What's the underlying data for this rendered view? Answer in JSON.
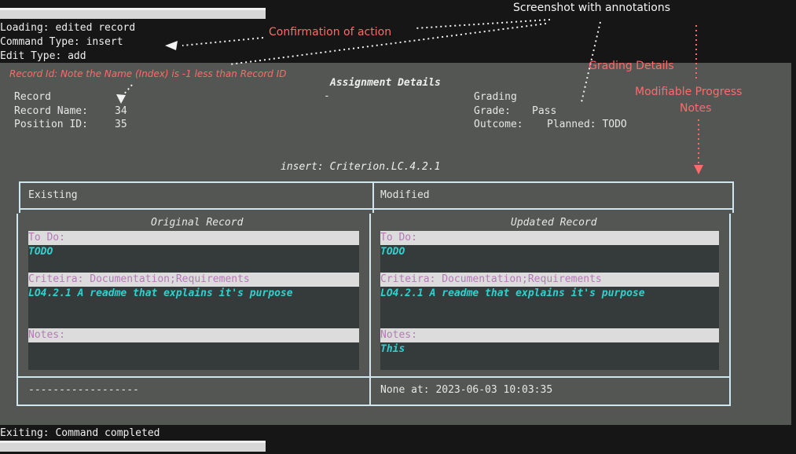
{
  "terminal_top": {
    "lines": [
      "Loading: edited record",
      "Command Type: insert",
      "Edit Type: add"
    ]
  },
  "terminal_bottom": {
    "exit_line": "Exiting: Command completed"
  },
  "annotations": {
    "title": "Screenshot with annotations",
    "confirmation": "Confirmation of action",
    "record_id_note": "Record Id: Note the Name (Index) is -1 less than Record ID",
    "grading_details": "Grading Details",
    "modifiable_notes_line1": "Modifiable Progress",
    "modifiable_notes_line2": "Notes"
  },
  "assignment": {
    "heading": "Assignment Details",
    "dash": "-",
    "record_label": "Record",
    "record_name_label": "Record Name:",
    "record_name_value": "34",
    "position_id_label": "Position ID:",
    "position_id_value": "35",
    "grading_label": "Grading",
    "grade_label": "Grade:",
    "grade_value": "Pass",
    "outcome_label": "Outcome:",
    "outcome_value": "Planned: TODO"
  },
  "action_line": "insert: Criterion.LC.4.2.1",
  "table": {
    "existing_header": "Existing",
    "modified_header": "Modified",
    "original_title": "Original Record",
    "updated_title": "Updated Record",
    "original": {
      "todo_label": "To Do:",
      "todo_value": "TODO",
      "criteria_label": "Criteira: Documentation;Requirements",
      "criteria_value": "LO4.2.1 A readme that explains it's purpose",
      "notes_label": "Notes:",
      "notes_value": ""
    },
    "updated": {
      "todo_label": "To Do:",
      "todo_value": "TODO",
      "criteria_label": "Criteira: Documentation;Requirements",
      "criteria_value": "LO4.2.1 A readme that explains it's purpose",
      "notes_label": "Notes:",
      "notes_value": "This"
    },
    "footer_left": "------------------",
    "footer_right": "None at: 2023-06-03 10:03:35"
  },
  "colors": {
    "background": "#161616",
    "panel": "#545654",
    "annotation": "#ff6a6a",
    "label_purple": "#b57ab5",
    "value_cyan": "#2fd1d0"
  }
}
